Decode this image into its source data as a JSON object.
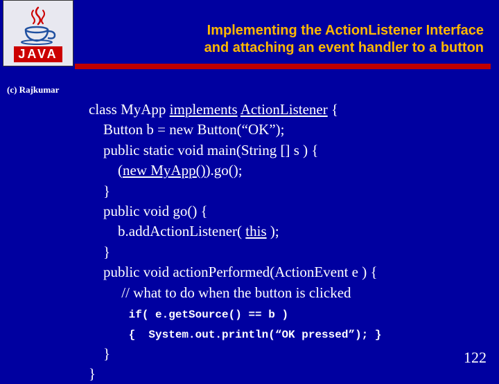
{
  "logo": {
    "label": "JAVA"
  },
  "title": {
    "line1": "Implementing the ActionListener Interface",
    "line2": "and attaching an event handler to a button"
  },
  "copyright": "(c) Rajkumar",
  "code": {
    "l1a": "class MyApp ",
    "l1b": "implements",
    "l1c": " ",
    "l1d": "ActionListener",
    "l1e": " {",
    "l2": "    Button b = new Button(“OK”);",
    "l3": "    public static void main(String [] s ) {",
    "l4a": "        (",
    "l4b": "new MyApp()",
    "l4c": ").go();",
    "l5": "    }",
    "l6": "    public void go() {",
    "l7a": "        b.addActionListener( ",
    "l7b": "this",
    "l7c": " );",
    "l8": "    }",
    "l9": "    public void actionPerformed(ActionEvent e ) {",
    "l10": "         // what to do when the button is clicked",
    "l11": "      if( e.getSource() == b )",
    "l12": "      {  System.out.println(“OK pressed”); }",
    "l13": "    }",
    "l14": "}"
  },
  "slideNumber": "122"
}
